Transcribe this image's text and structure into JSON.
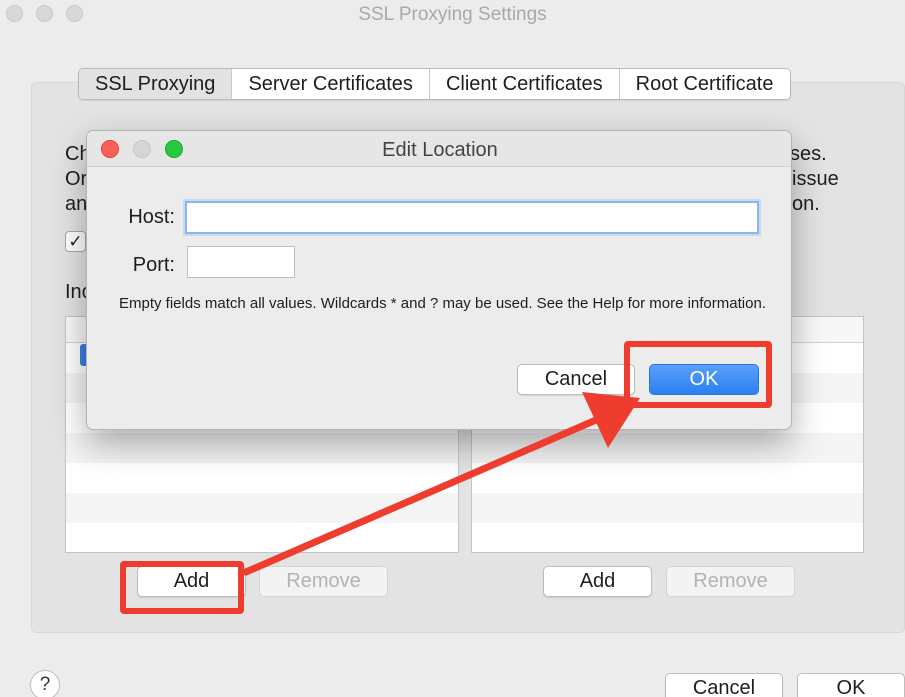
{
  "window": {
    "title": "SSL Proxying Settings",
    "tabs": [
      {
        "label": "SSL Proxying",
        "active": true
      },
      {
        "label": "Server Certificates",
        "active": false
      },
      {
        "label": "Client Certificates",
        "active": false
      },
      {
        "label": "Root Certificate",
        "active": false
      }
    ],
    "background_text": {
      "line1_start": "Ch",
      "line2_start": "Or",
      "line3_start": "an",
      "line1_end": "ses.",
      "line2_end": "issue",
      "line3_end": "on.",
      "include_label_partial": "Inc"
    },
    "checkbox_checked": true,
    "checkbox_glyph": "✓",
    "include_buttons": {
      "add": "Add",
      "remove": "Remove"
    },
    "exclude_buttons": {
      "add": "Add",
      "remove": "Remove"
    },
    "help_label": "?",
    "footer_buttons": {
      "cancel": "Cancel",
      "ok": "OK"
    }
  },
  "dialog": {
    "title": "Edit Location",
    "host_label": "Host:",
    "host_value": "",
    "port_label": "Port:",
    "port_value": "",
    "info": "Empty fields match all values. Wildcards * and ? may be used. See the Help for more information.",
    "cancel_label": "Cancel",
    "ok_label": "OK"
  },
  "colors": {
    "annotation": "#ee3d2f",
    "accent_blue": "#2b7ff0",
    "close": "#fe5f57",
    "minimize": "#d6d6d6",
    "zoom": "#28c840"
  }
}
